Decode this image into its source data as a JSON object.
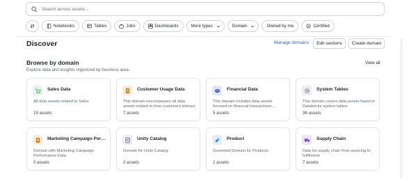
{
  "search": {
    "placeholder": "Search across assets..."
  },
  "filters": [
    {
      "label": "Notebooks",
      "icon": "notebook-icon"
    },
    {
      "label": "Tables",
      "icon": "table-icon"
    },
    {
      "label": "Jobs",
      "icon": "jobs-icon"
    },
    {
      "label": "Dashboards",
      "icon": "dashboard-icon"
    },
    {
      "label": "More types",
      "icon": "chevron-down-icon"
    },
    {
      "label": "Domain",
      "icon": "chevron-down-icon"
    },
    {
      "label": "Owned by me",
      "icon": ""
    },
    {
      "label": "Certified",
      "icon": "certified-icon"
    }
  ],
  "header": {
    "title": "Discover",
    "manage_link": "Manage domains",
    "edit_button": "Edit sections",
    "create_button": "Create domain"
  },
  "browse": {
    "title": "Browse by domain",
    "subtitle": "Explore data and insights organized by business area.",
    "view_all": "View all"
  },
  "domains": [
    {
      "name": "Sales Data",
      "description": "All data assets related to Sales",
      "count": "19 assets",
      "icon": "cart-icon",
      "color": "#5aa86b",
      "bg": "#e3f3e6"
    },
    {
      "name": "Customer Usage Data",
      "description": "This domain encompasses all data assets related to how customers interact with...",
      "count": "7 assets",
      "icon": "document-icon",
      "color": "#c8862f",
      "bg": "#f8ead6"
    },
    {
      "name": "Financial Data",
      "description": "This domain includes data assets focused on financial transactions,...",
      "count": "5 assets",
      "icon": "coin-icon",
      "color": "#3e5bc2",
      "bg": "#e3e8f8"
    },
    {
      "name": "System Tables",
      "description": "This domain covers data assets found in Databricks system tables",
      "count": "36 assets",
      "icon": "gear-icon",
      "color": "#6b7280",
      "bg": "#ebedf0"
    },
    {
      "name": "Marketing Campaign Perfor...",
      "description": "Domain with Marketing Campaign Performance Data",
      "count": "0 assets",
      "icon": "document-icon",
      "color": "#c8862f",
      "bg": "#f8ead6"
    },
    {
      "name": "Unity Catalog",
      "description": "Domain for Unity Catalog",
      "count": "0 assets",
      "icon": "catalog-icon",
      "color": "#6b7280",
      "bg": "#ebedf0"
    },
    {
      "name": "Product",
      "description": "Governed Domain for Products",
      "count": "2 assets",
      "icon": "tag-icon",
      "color": "#2b7fd6",
      "bg": "#e2eefb"
    },
    {
      "name": "Supply Chain",
      "description": "Data for supply chain from sourcing to fulfillment",
      "count": "7 assets",
      "icon": "truck-icon",
      "color": "#7a4fc4",
      "bg": "#ede5fa"
    }
  ]
}
